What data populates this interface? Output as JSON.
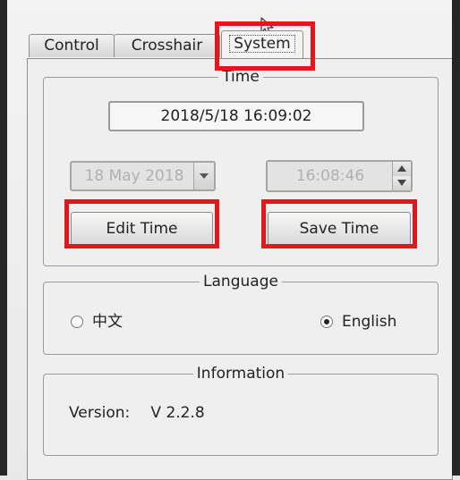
{
  "tabs": [
    {
      "label": "Control"
    },
    {
      "label": "Crosshair"
    },
    {
      "label": "System"
    }
  ],
  "active_tab": "System",
  "time_group": {
    "title": "Time",
    "current_datetime": "2018/5/18  16:09:02",
    "date_value": "18 May 2018",
    "time_value": "16:08:46",
    "edit_button": "Edit Time",
    "save_button": "Save Time"
  },
  "language_group": {
    "title": "Language",
    "options": [
      {
        "label": "中文",
        "selected": false
      },
      {
        "label": "English",
        "selected": true
      }
    ]
  },
  "info_group": {
    "title": "Information",
    "version_label": "Version:",
    "version_value": "V 2.2.8"
  },
  "colors": {
    "highlight": "#e4161c",
    "disabled_text": "#b0b0b0"
  }
}
